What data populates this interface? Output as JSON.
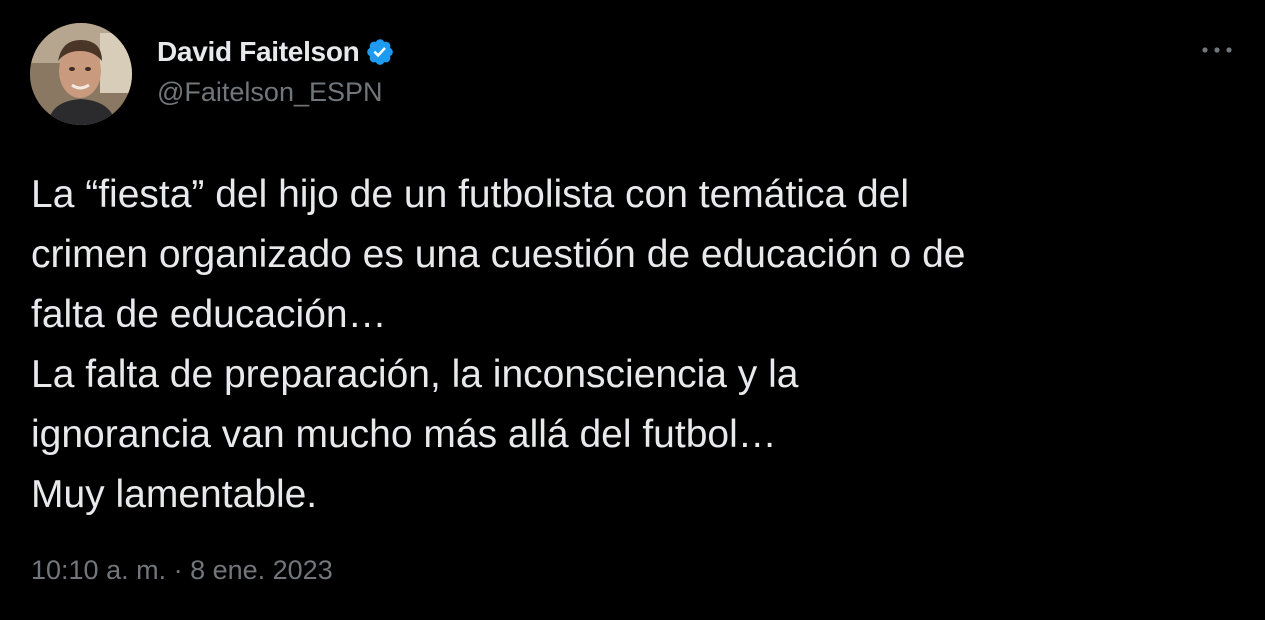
{
  "tweet": {
    "author": {
      "display_name": "David Faitelson",
      "handle": "@Faitelson_ESPN",
      "verified": true
    },
    "text_lines": [
      "La “fiesta” del hijo de un futbolista con temática del",
      "crimen organizado es una cuestión de educación o de",
      "falta de educación…",
      "La falta de preparación, la inconsciencia y la",
      "ignorancia van mucho más allá del futbol…",
      "Muy lamentable."
    ],
    "timestamp": "10:10 a. m. · 8 ene. 2023",
    "icons": {
      "verified": "verified-badge-icon",
      "more": "more-options-icon"
    },
    "colors": {
      "background": "#000000",
      "primary_text": "#e7e9ea",
      "secondary_text": "#71767b",
      "verified_blue": "#1d9bf0"
    }
  }
}
